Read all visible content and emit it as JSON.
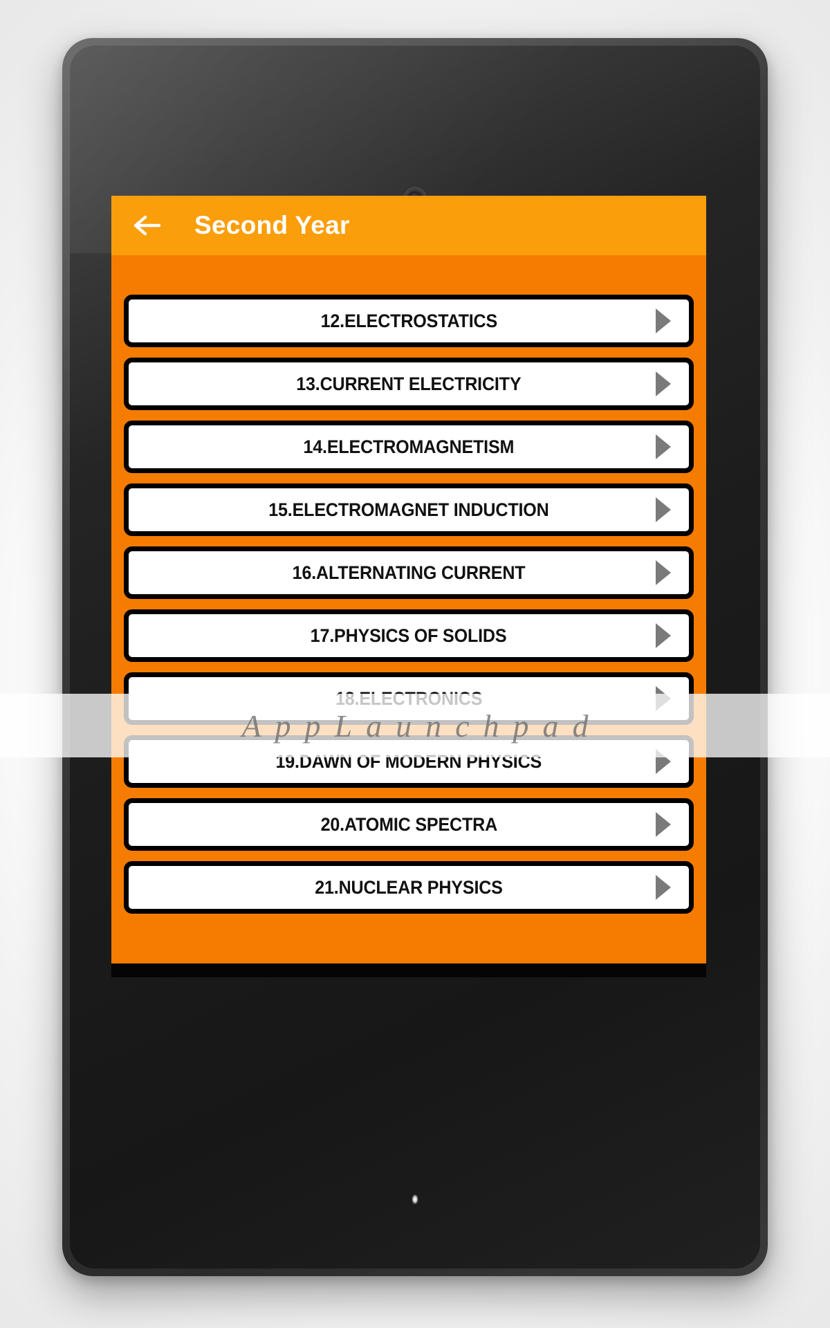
{
  "app": {
    "header": {
      "title": "Second Year",
      "back_icon": "back-arrow-icon",
      "background_color": "#FA9E0C",
      "title_color": "#FFFFFF"
    },
    "theme": {
      "body_orange": "#F57C00",
      "row_background": "#FFFFFF",
      "row_border": "#000000",
      "arrow_color": "#7A7A7A",
      "text_color": "#111111"
    },
    "list": {
      "item_arrow_icon": "chevron-right-triangle-icon",
      "items": [
        {
          "label": "12.ELECTROSTATICS"
        },
        {
          "label": "13.CURRENT ELECTRICITY"
        },
        {
          "label": "14.ELECTROMAGNETISM"
        },
        {
          "label": "15.ELECTROMAGNET INDUCTION"
        },
        {
          "label": "16.ALTERNATING CURRENT"
        },
        {
          "label": "17.PHYSICS OF SOLIDS"
        },
        {
          "label": "18.ELECTRONICS"
        },
        {
          "label": "19.DAWN OF MODERN PHYSICS"
        },
        {
          "label": "20.ATOMIC SPECTRA"
        },
        {
          "label": "21.NUCLEAR PHYSICS"
        }
      ]
    }
  },
  "device": {
    "camera_icon": "front-camera-icon",
    "led_icon": "notification-led-icon"
  },
  "watermark": {
    "text": "AppLaunchpad"
  }
}
